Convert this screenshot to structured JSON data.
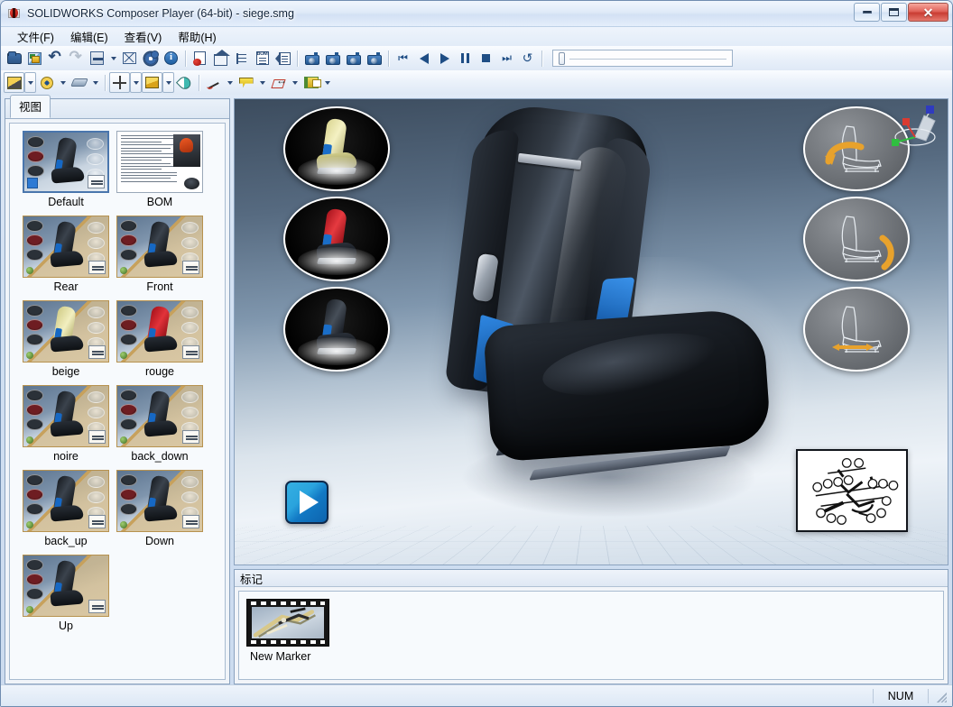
{
  "window": {
    "title": "SOLIDWORKS Composer Player (64-bit) - siege.smg",
    "app_icon": "composer-bug-icon",
    "buttons": {
      "minimize": "–",
      "maximize": "□",
      "close": "✕"
    }
  },
  "menubar": {
    "items": [
      {
        "label": "文件(F)",
        "name": "menu-file"
      },
      {
        "label": "编辑(E)",
        "name": "menu-edit"
      },
      {
        "label": "查看(V)",
        "name": "menu-view"
      },
      {
        "label": "帮助(H)",
        "name": "menu-help"
      }
    ]
  },
  "toolbar_row1": {
    "icons": [
      "open-folder-icon",
      "save-as-icon",
      "undo-icon",
      "redo-icon",
      "render-quality-icon",
      "fit-all-icon",
      "settings-gear-icon",
      "info-icon",
      "publish-pdf-icon",
      "home-view-icon",
      "assembly-tree-icon",
      "bom-table-icon",
      "annotation-panel-icon",
      "snapshot-icon",
      "snapshot-play-icon",
      "snapshot-stop-icon",
      "snapshot-next-icon"
    ],
    "player": [
      "rewind-start-icon",
      "step-back-icon",
      "play-icon",
      "pause-icon",
      "stop-icon",
      "step-forward-icon",
      "loop-icon"
    ],
    "timeline": {
      "name": "timeline-slider",
      "position": 0
    }
  },
  "toolbar_row2": {
    "icons": [
      "lighting-icon",
      "render-mode-icon",
      "ground-shadow-icon",
      "pan-move-icon",
      "paint-bucket-icon",
      "paint-drop-icon",
      "freehand-line-icon",
      "callout-label-icon",
      "measure-dimension-icon",
      "image-library-icon"
    ]
  },
  "left_panel": {
    "tab_label": "视图",
    "tab_name": "views-tab",
    "views": [
      {
        "label": "Default",
        "style": "seat",
        "selected": true
      },
      {
        "label": "BOM",
        "style": "doc",
        "selected": false
      },
      {
        "label": "Rear",
        "style": "seat",
        "selected": false
      },
      {
        "label": "Front",
        "style": "seat",
        "selected": false
      },
      {
        "label": "beige",
        "style": "beige",
        "selected": false
      },
      {
        "label": "rouge",
        "style": "rouge",
        "selected": false
      },
      {
        "label": "noire",
        "style": "seat",
        "selected": false
      },
      {
        "label": "back_down",
        "style": "seat",
        "selected": false
      },
      {
        "label": "back_up",
        "style": "seat",
        "selected": false
      },
      {
        "label": "Down",
        "style": "seat",
        "selected": false
      },
      {
        "label": "Up",
        "style": "seat",
        "selected": false
      }
    ]
  },
  "viewport": {
    "name": "3d-viewport",
    "left_thumbnails": [
      {
        "name": "viewport-thumb-beige",
        "variant": "beige"
      },
      {
        "name": "viewport-thumb-rouge",
        "variant": "rouge"
      },
      {
        "name": "viewport-thumb-noire",
        "variant": "noire"
      }
    ],
    "right_thumbnails": [
      {
        "name": "viewport-thumb-backrest-tilt",
        "arrow": "curved-arrow-up-left"
      },
      {
        "name": "viewport-thumb-cushion-tilt",
        "arrow": "curved-arrow-right"
      },
      {
        "name": "viewport-thumb-slide",
        "arrow": "straight-arrow-horizontal"
      }
    ],
    "play_button": {
      "name": "play-overlay-button",
      "icon": "play-triangle-icon"
    },
    "bom_overlay": {
      "name": "exploded-view-overlay"
    },
    "nav_gizmo": {
      "name": "navigation-axis-gizmo",
      "axes": [
        "x",
        "y",
        "z"
      ]
    },
    "colors": {
      "seat_body": "#14181d",
      "seat_accent": "#1668c4",
      "background_top": "#3c4c5e",
      "background_bottom": "#ccd9e6"
    }
  },
  "markers_panel": {
    "header_label": "标记",
    "items": [
      {
        "label": "New Marker",
        "name": "marker-new-marker"
      }
    ]
  },
  "statusbar": {
    "num_label": "NUM",
    "resize_grip": "resize-grip-icon"
  }
}
